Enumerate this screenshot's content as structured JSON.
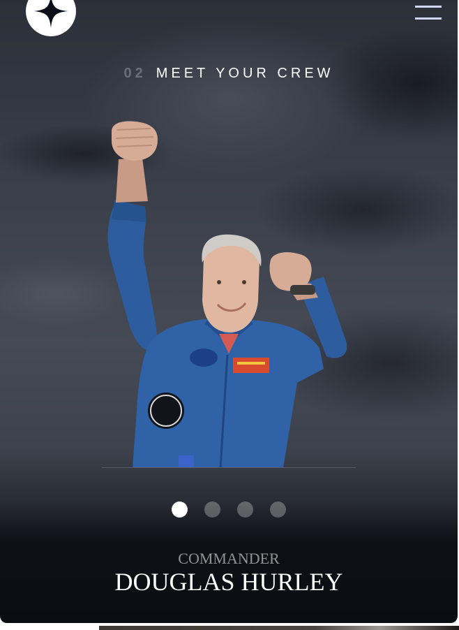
{
  "header": {
    "logo_icon": "compass-star-icon",
    "menu_icon": "hamburger-menu-icon"
  },
  "page": {
    "number": "02",
    "title": "MEET YOUR CREW"
  },
  "crew": {
    "role": "COMMANDER",
    "name": "DOUGLAS HURLEY",
    "portrait": "astronaut-portrait"
  },
  "carousel": {
    "count": 4,
    "active_index": 0
  },
  "colors": {
    "accent": "#d0d6f9",
    "dark": "#0b0d13",
    "white": "#ffffff"
  }
}
